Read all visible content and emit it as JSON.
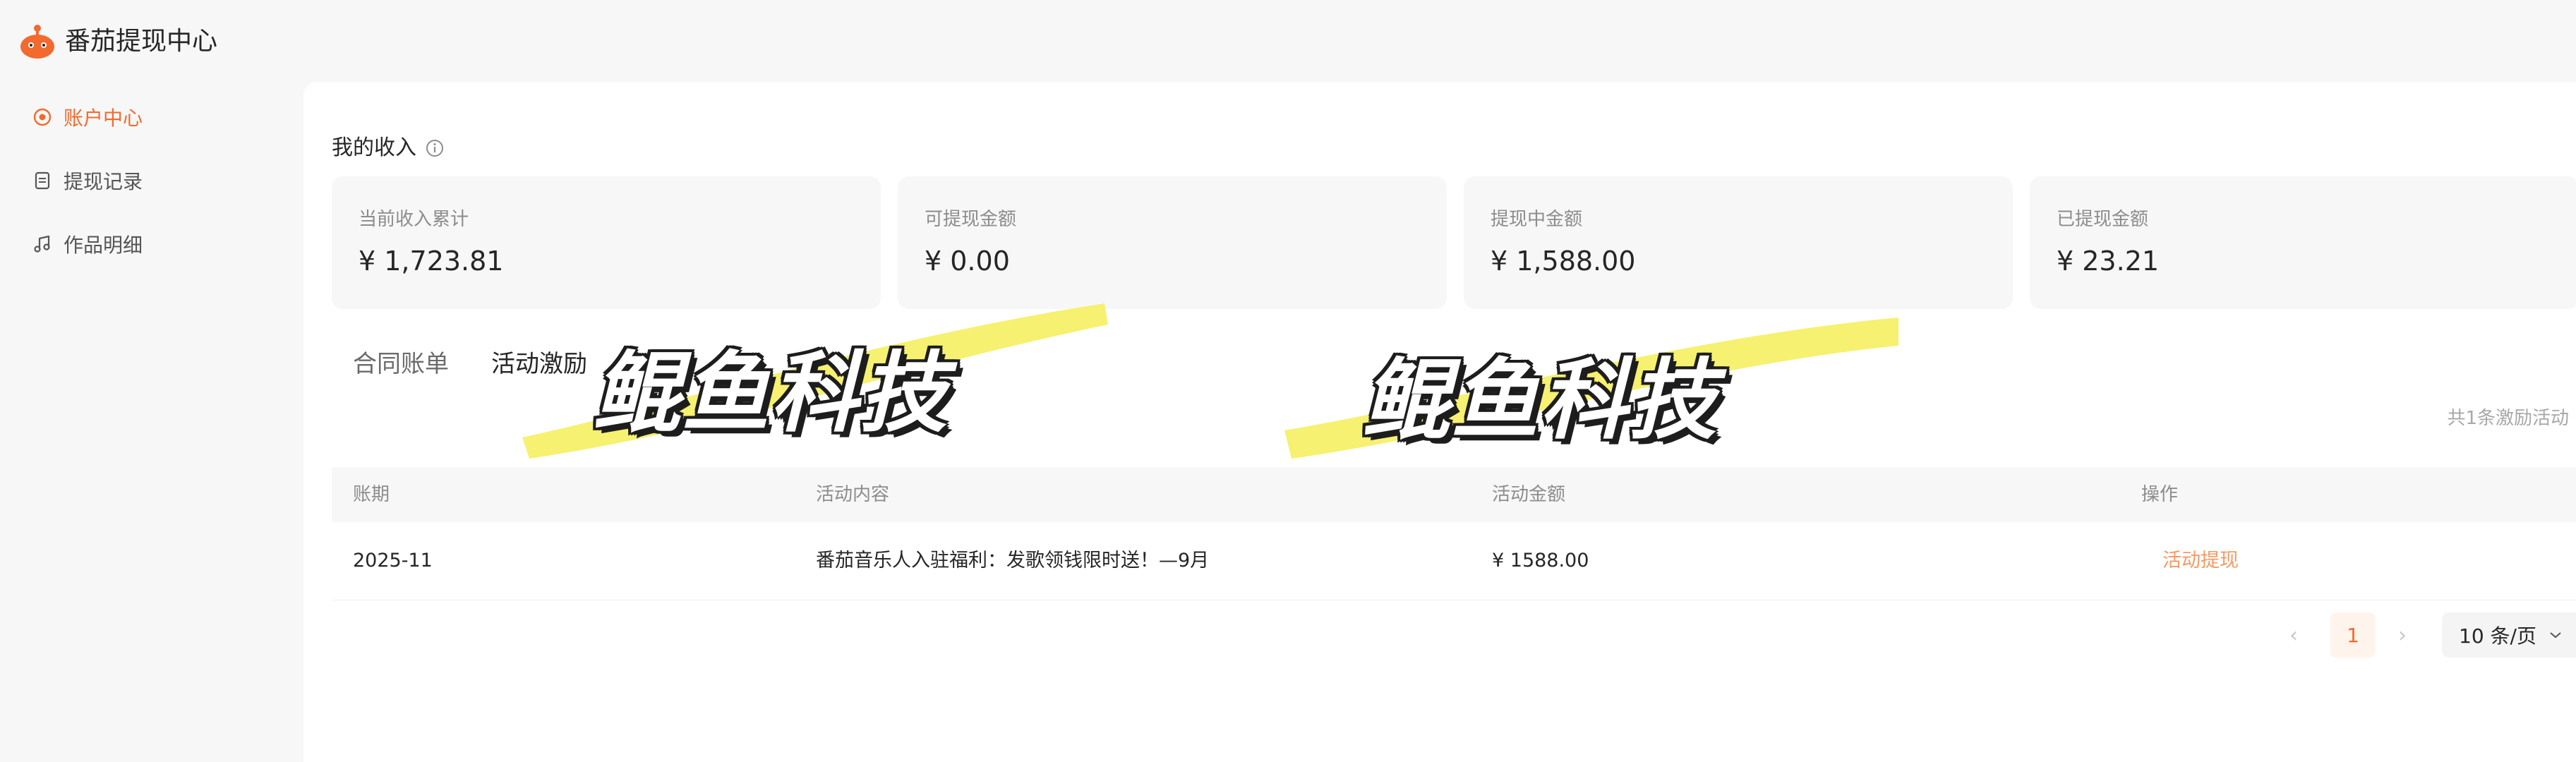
{
  "app": {
    "title": "番茄提现中心",
    "brand_color": "#f26a2e"
  },
  "sidebar": {
    "items": [
      {
        "label": "账户中心",
        "icon": "account-circle-icon",
        "active": true
      },
      {
        "label": "提现记录",
        "icon": "document-icon",
        "active": false
      },
      {
        "label": "作品明细",
        "icon": "music-note-icon",
        "active": false
      }
    ]
  },
  "income": {
    "title": "我的收入",
    "cards": [
      {
        "label": "当前收入累计",
        "value": "¥ 1,723.81"
      },
      {
        "label": "可提现金额",
        "value": "¥ 0.00"
      },
      {
        "label": "提现中金额",
        "value": "¥ 1,588.00"
      },
      {
        "label": "已提现金额",
        "value": "¥ 23.21"
      }
    ]
  },
  "tabs": [
    {
      "label": "合同账单",
      "active": false
    },
    {
      "label": "活动激励",
      "active": true
    }
  ],
  "summary": "共1条激励活动",
  "table": {
    "headers": [
      "账期",
      "活动内容",
      "活动金额",
      "操作"
    ],
    "rows": [
      {
        "period": "2025-11",
        "content": "番茄音乐人入驻福利：发歌领钱限时送！—9月",
        "amount": "¥ 1588.00",
        "action": "活动提现"
      }
    ]
  },
  "pagination": {
    "current_page": "1",
    "page_size": "10 条/页"
  },
  "watermark": {
    "text": "鲲鱼科技",
    "highlight_color": "#f5f060"
  }
}
